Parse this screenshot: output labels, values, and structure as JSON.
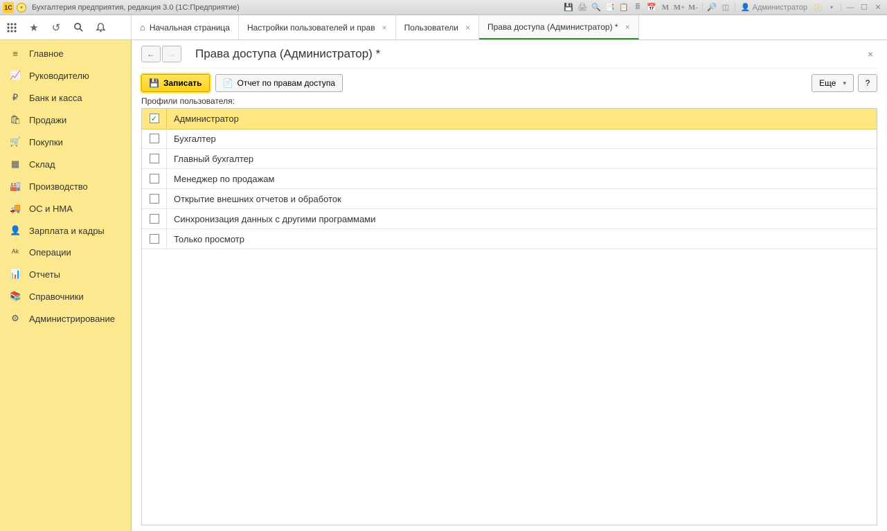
{
  "titlebar": {
    "app_icon_text": "1C",
    "title": "Бухгалтерия предприятия, редакция 3.0  (1С:Предприятие)",
    "user_label": "Администратор",
    "m_labels": [
      "M",
      "M+",
      "M-"
    ]
  },
  "tabs": {
    "home": "Начальная страница",
    "items": [
      {
        "label": "Настройки пользователей и прав",
        "closable": true
      },
      {
        "label": "Пользователи",
        "closable": true
      },
      {
        "label": "Права доступа (Администратор) *",
        "closable": true,
        "active": true
      }
    ]
  },
  "sidebar": {
    "items": [
      {
        "icon": "≡",
        "label": "Главное"
      },
      {
        "icon": "📈",
        "label": "Руководителю"
      },
      {
        "icon": "₽",
        "label": "Банк и касса"
      },
      {
        "icon": "🛍",
        "label": "Продажи"
      },
      {
        "icon": "🛒",
        "label": "Покупки"
      },
      {
        "icon": "▦",
        "label": "Склад"
      },
      {
        "icon": "🏭",
        "label": "Производство"
      },
      {
        "icon": "🚚",
        "label": "ОС и НМА"
      },
      {
        "icon": "👤",
        "label": "Зарплата и кадры"
      },
      {
        "icon": "ᴬᵏ",
        "label": "Операции"
      },
      {
        "icon": "📊",
        "label": "Отчеты"
      },
      {
        "icon": "📚",
        "label": "Справочники"
      },
      {
        "icon": "⚙",
        "label": "Администрирование"
      }
    ]
  },
  "page": {
    "title": "Права доступа (Администратор) *",
    "save_label": "Записать",
    "report_label": "Отчет по правам доступа",
    "more_label": "Еще",
    "help_label": "?",
    "profiles_label": "Профили пользователя:"
  },
  "profiles": [
    {
      "checked": true,
      "name": "Администратор",
      "selected": true
    },
    {
      "checked": false,
      "name": "Бухгалтер"
    },
    {
      "checked": false,
      "name": "Главный бухгалтер"
    },
    {
      "checked": false,
      "name": "Менеджер по продажам"
    },
    {
      "checked": false,
      "name": "Открытие внешних отчетов и обработок"
    },
    {
      "checked": false,
      "name": "Синхронизация данных с другими программами"
    },
    {
      "checked": false,
      "name": "Только просмотр"
    }
  ]
}
